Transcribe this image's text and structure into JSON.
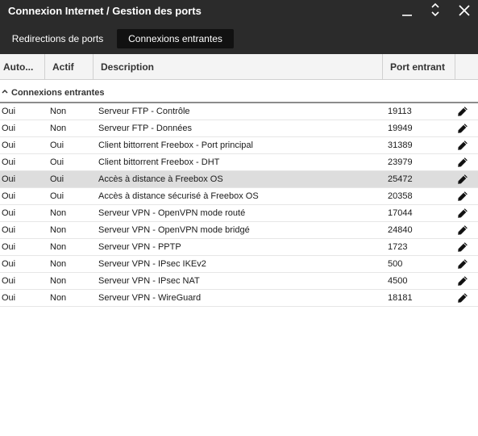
{
  "window": {
    "title": "Connexion Internet / Gestion des ports"
  },
  "tabs": [
    {
      "label": "Redirections de ports",
      "active": false
    },
    {
      "label": "Connexions entrantes",
      "active": true
    }
  ],
  "table": {
    "columns": [
      "Auto...",
      "Actif",
      "Description",
      "Port entrant"
    ],
    "group_label": "Connexions entrantes",
    "rows": [
      {
        "auto": "Oui",
        "actif": "Non",
        "description": "Serveur FTP - Contrôle",
        "port": "19113"
      },
      {
        "auto": "Oui",
        "actif": "Non",
        "description": "Serveur FTP - Données",
        "port": "19949"
      },
      {
        "auto": "Oui",
        "actif": "Oui",
        "description": "Client bittorrent Freebox - Port principal",
        "port": "31389"
      },
      {
        "auto": "Oui",
        "actif": "Oui",
        "description": "Client bittorrent Freebox - DHT",
        "port": "23979"
      },
      {
        "auto": "Oui",
        "actif": "Oui",
        "description": "Accès à distance à Freebox OS",
        "port": "25472",
        "selected": true
      },
      {
        "auto": "Oui",
        "actif": "Oui",
        "description": "Accès à distance sécurisé à Freebox OS",
        "port": "20358"
      },
      {
        "auto": "Oui",
        "actif": "Non",
        "description": "Serveur VPN - OpenVPN mode routé",
        "port": "17044"
      },
      {
        "auto": "Oui",
        "actif": "Non",
        "description": "Serveur VPN - OpenVPN mode bridgé",
        "port": "24840"
      },
      {
        "auto": "Oui",
        "actif": "Non",
        "description": "Serveur VPN - PPTP",
        "port": "1723"
      },
      {
        "auto": "Oui",
        "actif": "Non",
        "description": "Serveur VPN - IPsec IKEv2",
        "port": "500"
      },
      {
        "auto": "Oui",
        "actif": "Non",
        "description": "Serveur VPN - IPsec NAT",
        "port": "4500"
      },
      {
        "auto": "Oui",
        "actif": "Non",
        "description": "Serveur VPN - WireGuard",
        "port": "18181"
      }
    ]
  },
  "icons": {
    "minimize": "minimize-icon",
    "resize": "resize-icon",
    "close": "close-icon",
    "group_toggle": "chevron-up-icon",
    "row_edit": "pencil-icon"
  },
  "colors": {
    "titlebar": "#2b2b2b",
    "active_tab": "#111111",
    "selected_row": "#dddddd"
  }
}
